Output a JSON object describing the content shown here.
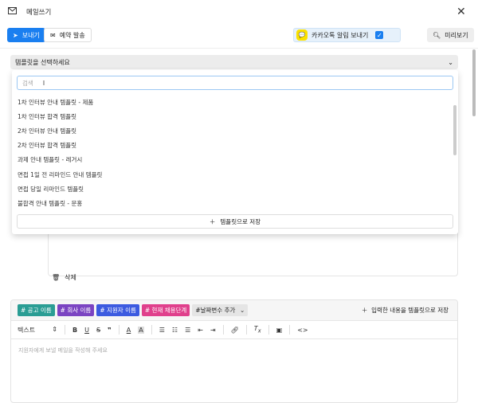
{
  "header": {
    "title": "메일쓰기"
  },
  "toolbar": {
    "send": "보내기",
    "reserve": "예약 발송",
    "kakao": "카카오톡 알림 보내기",
    "kakao_checked": true,
    "preview": "미리보기"
  },
  "template_select": {
    "placeholder": "템플릿을 선택하세요"
  },
  "dropdown": {
    "search_placeholder": "검색",
    "items": [
      "1차 인터뷰 안내 템플릿 - 제품",
      "1차 인터뷰 합격 템플릿",
      "2차 인터뷰 안내 템플릿",
      "2차 인터뷰 합격 템플릿",
      "과제 안내 템플릿 - 레거시",
      "면접 1일 전 리마인드 안내 템플릿",
      "면접 당일 리마인드 템플릿",
      "불합격 안내 템플릿 - 문홍"
    ],
    "save_label": "템플릿으로 저장"
  },
  "delete_label": "삭제",
  "editor": {
    "variables": [
      {
        "label": "# 공고 이름",
        "color": "#2a9d94"
      },
      {
        "label": "# 회사 이름",
        "color": "#7b44c2"
      },
      {
        "label": "# 지원자 이름",
        "color": "#3c5be0"
      },
      {
        "label": "# 현재 채용단계",
        "color": "#e0408c"
      }
    ],
    "date_variable": "#날짜변수 추가",
    "save_template": "입력한 내용을 템플릿으로 저장",
    "format_select": "텍스트",
    "placeholder": "지원자에게 보낼 메일을 작성해 주세요"
  }
}
